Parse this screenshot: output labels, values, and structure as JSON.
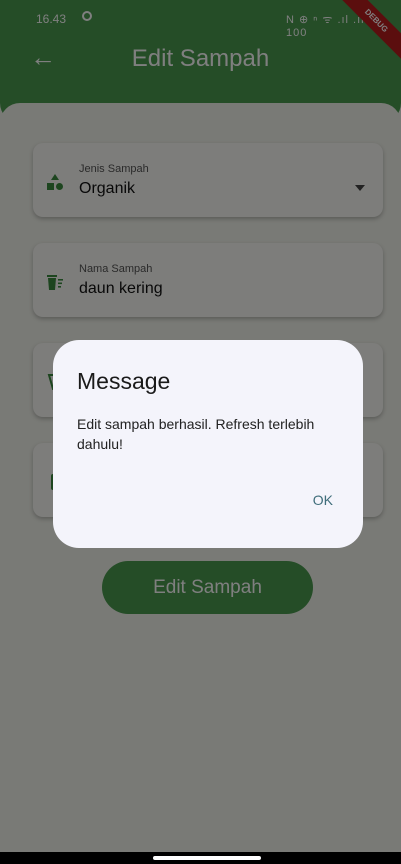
{
  "status_bar": {
    "time": "16.43",
    "icons_text": "N ⊕ ⁿ ᯤ .ıl .ıl ○ 100"
  },
  "app_bar": {
    "title": "Edit Sampah",
    "debug_label": "DEBUG"
  },
  "form": {
    "fields": [
      {
        "label": "Jenis Sampah",
        "value": "Organik",
        "icon": "shapes-icon"
      },
      {
        "label": "Nama Sampah",
        "value": "daun kering",
        "icon": "trash-list-icon"
      },
      {
        "label": "",
        "value": "",
        "icon": "scale-icon"
      },
      {
        "label": "",
        "value": "",
        "icon": "phone-icon"
      }
    ],
    "submit_label": "Edit Sampah"
  },
  "dialog": {
    "title": "Message",
    "message": "Edit sampah berhasil. Refresh terlebih dahulu!",
    "ok_label": "OK"
  },
  "colors": {
    "primary": "#4a9a4f",
    "dialog_bg": "#f4f4fb",
    "ok_text": "#3f6d7a"
  }
}
